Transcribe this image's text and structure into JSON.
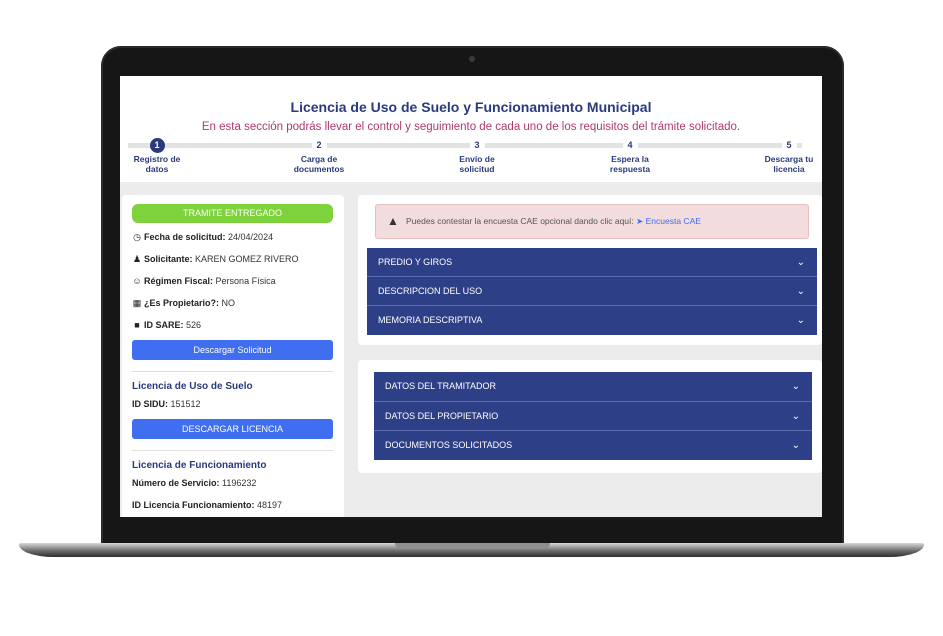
{
  "header": {
    "title": "Licencia de Uso de Suelo y Funcionamiento Municipal",
    "subtitle": "En esta sección podrás llevar el control y seguimiento de cada uno de los requisitos del trámite solicitado."
  },
  "steps": [
    {
      "number": "1",
      "label_1": "Registro de",
      "label_2": "datos"
    },
    {
      "number": "2",
      "label_1": "Carga de",
      "label_2": "documentos"
    },
    {
      "number": "3",
      "label_1": "Envío de",
      "label_2": "solicitud"
    },
    {
      "number": "4",
      "label_1": "Espera la",
      "label_2": "respuesta"
    },
    {
      "number": "5",
      "label_1": "Descarga tu",
      "label_2": "licencia"
    }
  ],
  "summary": {
    "status": "TRAMITE ENTREGADO",
    "fecha_label": "Fecha de solicitud:",
    "fecha_value": "24/04/2024",
    "solicitante_label": "Solicitante:",
    "solicitante_value": "KAREN GOMEZ RIVERO",
    "regimen_label": "Régimen Fiscal:",
    "regimen_value": "Persona Física",
    "propietario_label": "¿Es Propietario?:",
    "propietario_value": "NO",
    "sare_label": "ID SARE:",
    "sare_value": "526",
    "download_solicitud": "Descargar Solicitud"
  },
  "uso_suelo": {
    "title": "Licencia de Uso de Suelo",
    "sidu_label": "ID SIDU:",
    "sidu_value": "151512",
    "download": "DESCARGAR LICENCIA"
  },
  "funcionamiento": {
    "title": "Licencia de Funcionamiento",
    "servicio_label": "Número de Servicio:",
    "servicio_value": "1196232",
    "id_label": "ID Licencia Funcionamiento:",
    "id_value": "48197"
  },
  "alert": {
    "text": "Puedes contestar la encuesta CAE opcional dando clic aquí:",
    "link": "Encuesta CAE"
  },
  "accordion_1": [
    "PREDIO Y GIROS",
    "DESCRIPCION DEL USO",
    "MEMORIA DESCRIPTIVA"
  ],
  "accordion_2": [
    "DATOS DEL TRAMITADOR",
    "DATOS DEL PROPIETARIO",
    "DOCUMENTOS SOLICITADOS"
  ],
  "colors": {
    "primary": "#2a3a7c",
    "accent_pink": "#b0386f",
    "success": "#7ed23b",
    "button_blue": "#3f6ef0",
    "accordion": "#2d3f86"
  }
}
